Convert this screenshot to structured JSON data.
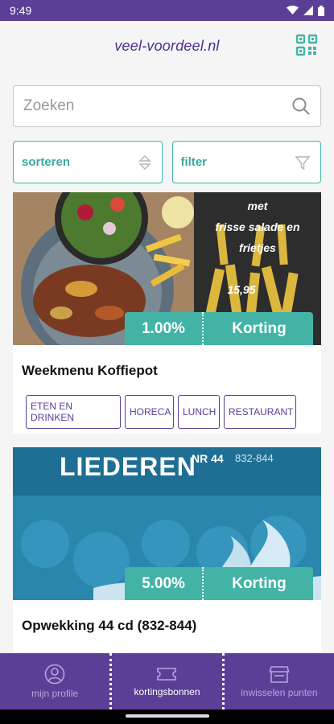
{
  "status": {
    "time": "9:49"
  },
  "header": {
    "title": "veel-voordeel.nl"
  },
  "search": {
    "placeholder": "Zoeken"
  },
  "controls": {
    "sort_label": "sorteren",
    "filter_label": "filter"
  },
  "deals": [
    {
      "title": "Weekmenu Koffiepot",
      "discount_pct": "1.00%",
      "discount_label": "Korting",
      "image_text": [
        "met",
        "frisse salade en",
        "frietjes",
        "15,95"
      ],
      "tags": [
        "ETEN EN DRINKEN",
        "HORECA",
        "LUNCH",
        "RESTAURANT"
      ]
    },
    {
      "title": "Opwekking 44 cd (832-844)",
      "discount_pct": "5.00%",
      "discount_label": "Korting",
      "image_text": [
        "LIEDEREN",
        "NR 44",
        "832-844"
      ]
    }
  ],
  "nav": {
    "items": [
      {
        "label": "mijn profile",
        "icon": "person-icon"
      },
      {
        "label": "kortingsbonnen",
        "icon": "ticket-icon"
      },
      {
        "label": "inwisselen punten",
        "icon": "store-icon"
      }
    ]
  },
  "colors": {
    "brand": "#5b3f97",
    "accent": "#43b3a6"
  }
}
